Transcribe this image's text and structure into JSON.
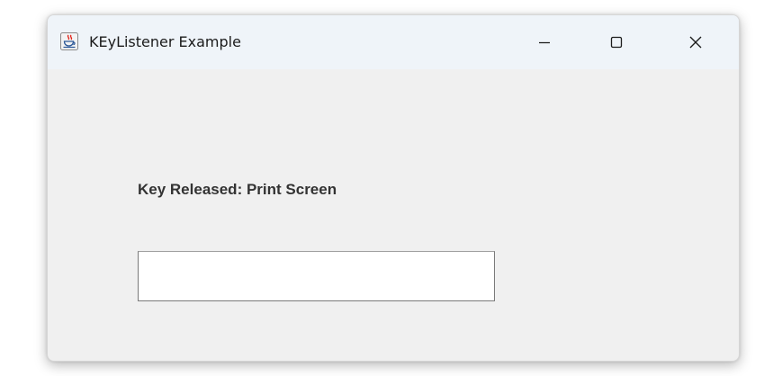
{
  "window": {
    "title": "KEyListener Example",
    "icon": "java-cup-icon",
    "controls": {
      "minimize_icon": "minimize-icon",
      "maximize_icon": "maximize-icon",
      "close_icon": "close-icon"
    }
  },
  "main": {
    "status_label": "Key Released: Print Screen",
    "input": {
      "value": "",
      "placeholder": ""
    }
  },
  "colors": {
    "titlebar_bg": "#eff4f9",
    "window_bg": "#f0f0f0",
    "label_text": "#333333"
  }
}
